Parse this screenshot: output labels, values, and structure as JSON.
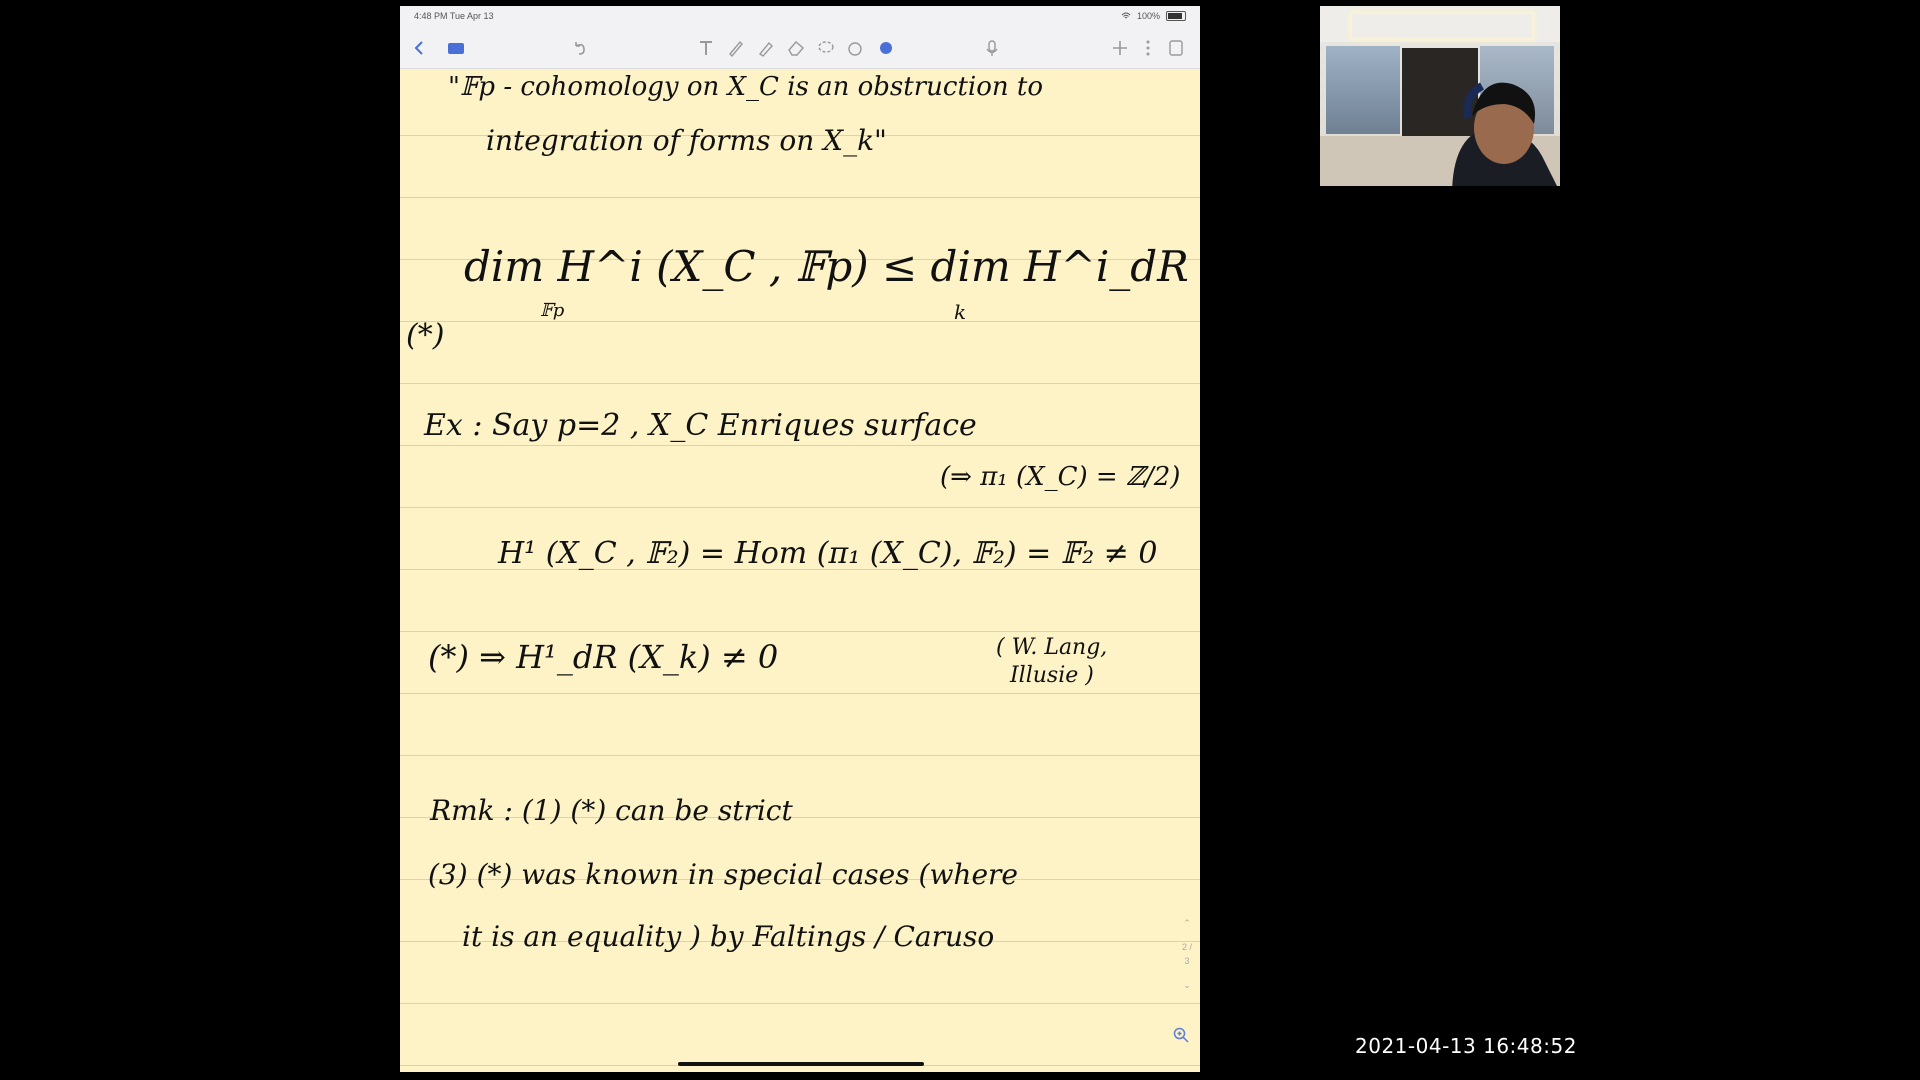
{
  "status_bar": {
    "time_date": "4:48 PM   Tue Apr 13",
    "battery": "100%"
  },
  "toolbar": {
    "icons": [
      "chevron-left-icon",
      "documents-icon",
      "undo-icon",
      "text-tool-icon",
      "pen-icon",
      "highlighter-icon",
      "eraser-icon",
      "lasso-icon",
      "shapes-icon",
      "laser-icon",
      "microphone-icon",
      "add-icon",
      "more-icon",
      "pages-icon"
    ]
  },
  "notes": {
    "line1": "\"𝔽p - cohomology  on  X_C  is  an  obstruction  to",
    "line2": "integration  of  forms  on  X_k\"",
    "dim_eq": "dim   H^i (X_C , 𝔽p)  ≤  dim  H^i_dR (X_k)",
    "dim_sub_left": "𝔽p",
    "dim_sub_right": "k",
    "star": "(*)",
    "example": "Ex :  Say   p=2 ,   X_C  Enriques  surface",
    "example_implies": "(⇒ π₁ (X_C) = ℤ/2)",
    "h1_eq": "H¹ (X_C , 𝔽₂)  =  Hom (π₁ (X_C), 𝔽₂)  =  𝔽₂ ≠ 0",
    "star_eq": "(*)   ⇒     H¹_dR (X_k)  ≠  0",
    "citation": "( W. Lang,\n  Illusie )",
    "remark1": "Rmk :  (1)    (*)   can   be   strict",
    "remark3": "(3)  (*)  was  known  in  special  cases  (where",
    "remark3b": "it  is  an  equality )  by   Faltings / Caruso"
  },
  "page_indicator": "2 / 3",
  "timestamp": "2021-04-13  16:48:52"
}
